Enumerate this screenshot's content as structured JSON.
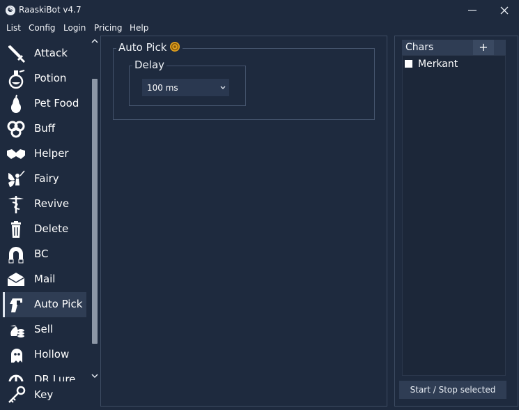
{
  "window": {
    "title": "RaaskiBot v4.7",
    "app_icon_glyph": "☯"
  },
  "menu": [
    "List",
    "Config",
    "Login",
    "Pricing",
    "Help"
  ],
  "sidebar": {
    "items": [
      {
        "label": "Attack",
        "icon": "sword-icon"
      },
      {
        "label": "Potion",
        "icon": "potion-icon"
      },
      {
        "label": "Pet Food",
        "icon": "pear-icon"
      },
      {
        "label": "Buff",
        "icon": "triskelion-icon"
      },
      {
        "label": "Helper",
        "icon": "handshake-icon"
      },
      {
        "label": "Fairy",
        "icon": "fairy-icon"
      },
      {
        "label": "Revive",
        "icon": "caduceus-icon"
      },
      {
        "label": "Delete",
        "icon": "trash-icon"
      },
      {
        "label": "BC",
        "icon": "magnet-icon"
      },
      {
        "label": "Mail",
        "icon": "envelope-icon"
      },
      {
        "label": "Auto Pick",
        "icon": "grab-icon"
      },
      {
        "label": "Sell",
        "icon": "money-bag-icon"
      },
      {
        "label": "Hollow",
        "icon": "ghost-icon"
      },
      {
        "label": "DR Lure",
        "icon": "lure-icon"
      },
      {
        "label": "Key",
        "icon": "key-icon"
      }
    ],
    "active": "Auto Pick"
  },
  "main": {
    "section_title": "Auto Pick",
    "delay": {
      "label": "Delay",
      "value": "100 ms"
    }
  },
  "chars": {
    "title": "Chars",
    "add_label": "+",
    "items": [
      {
        "name": "Merkant",
        "checked": false
      }
    ],
    "start_stop_label": "Start / Stop selected"
  },
  "colors": {
    "background": "#1e2a3e",
    "panel": "#2f3d54",
    "border": "#45546d",
    "text": "#ffffff"
  }
}
